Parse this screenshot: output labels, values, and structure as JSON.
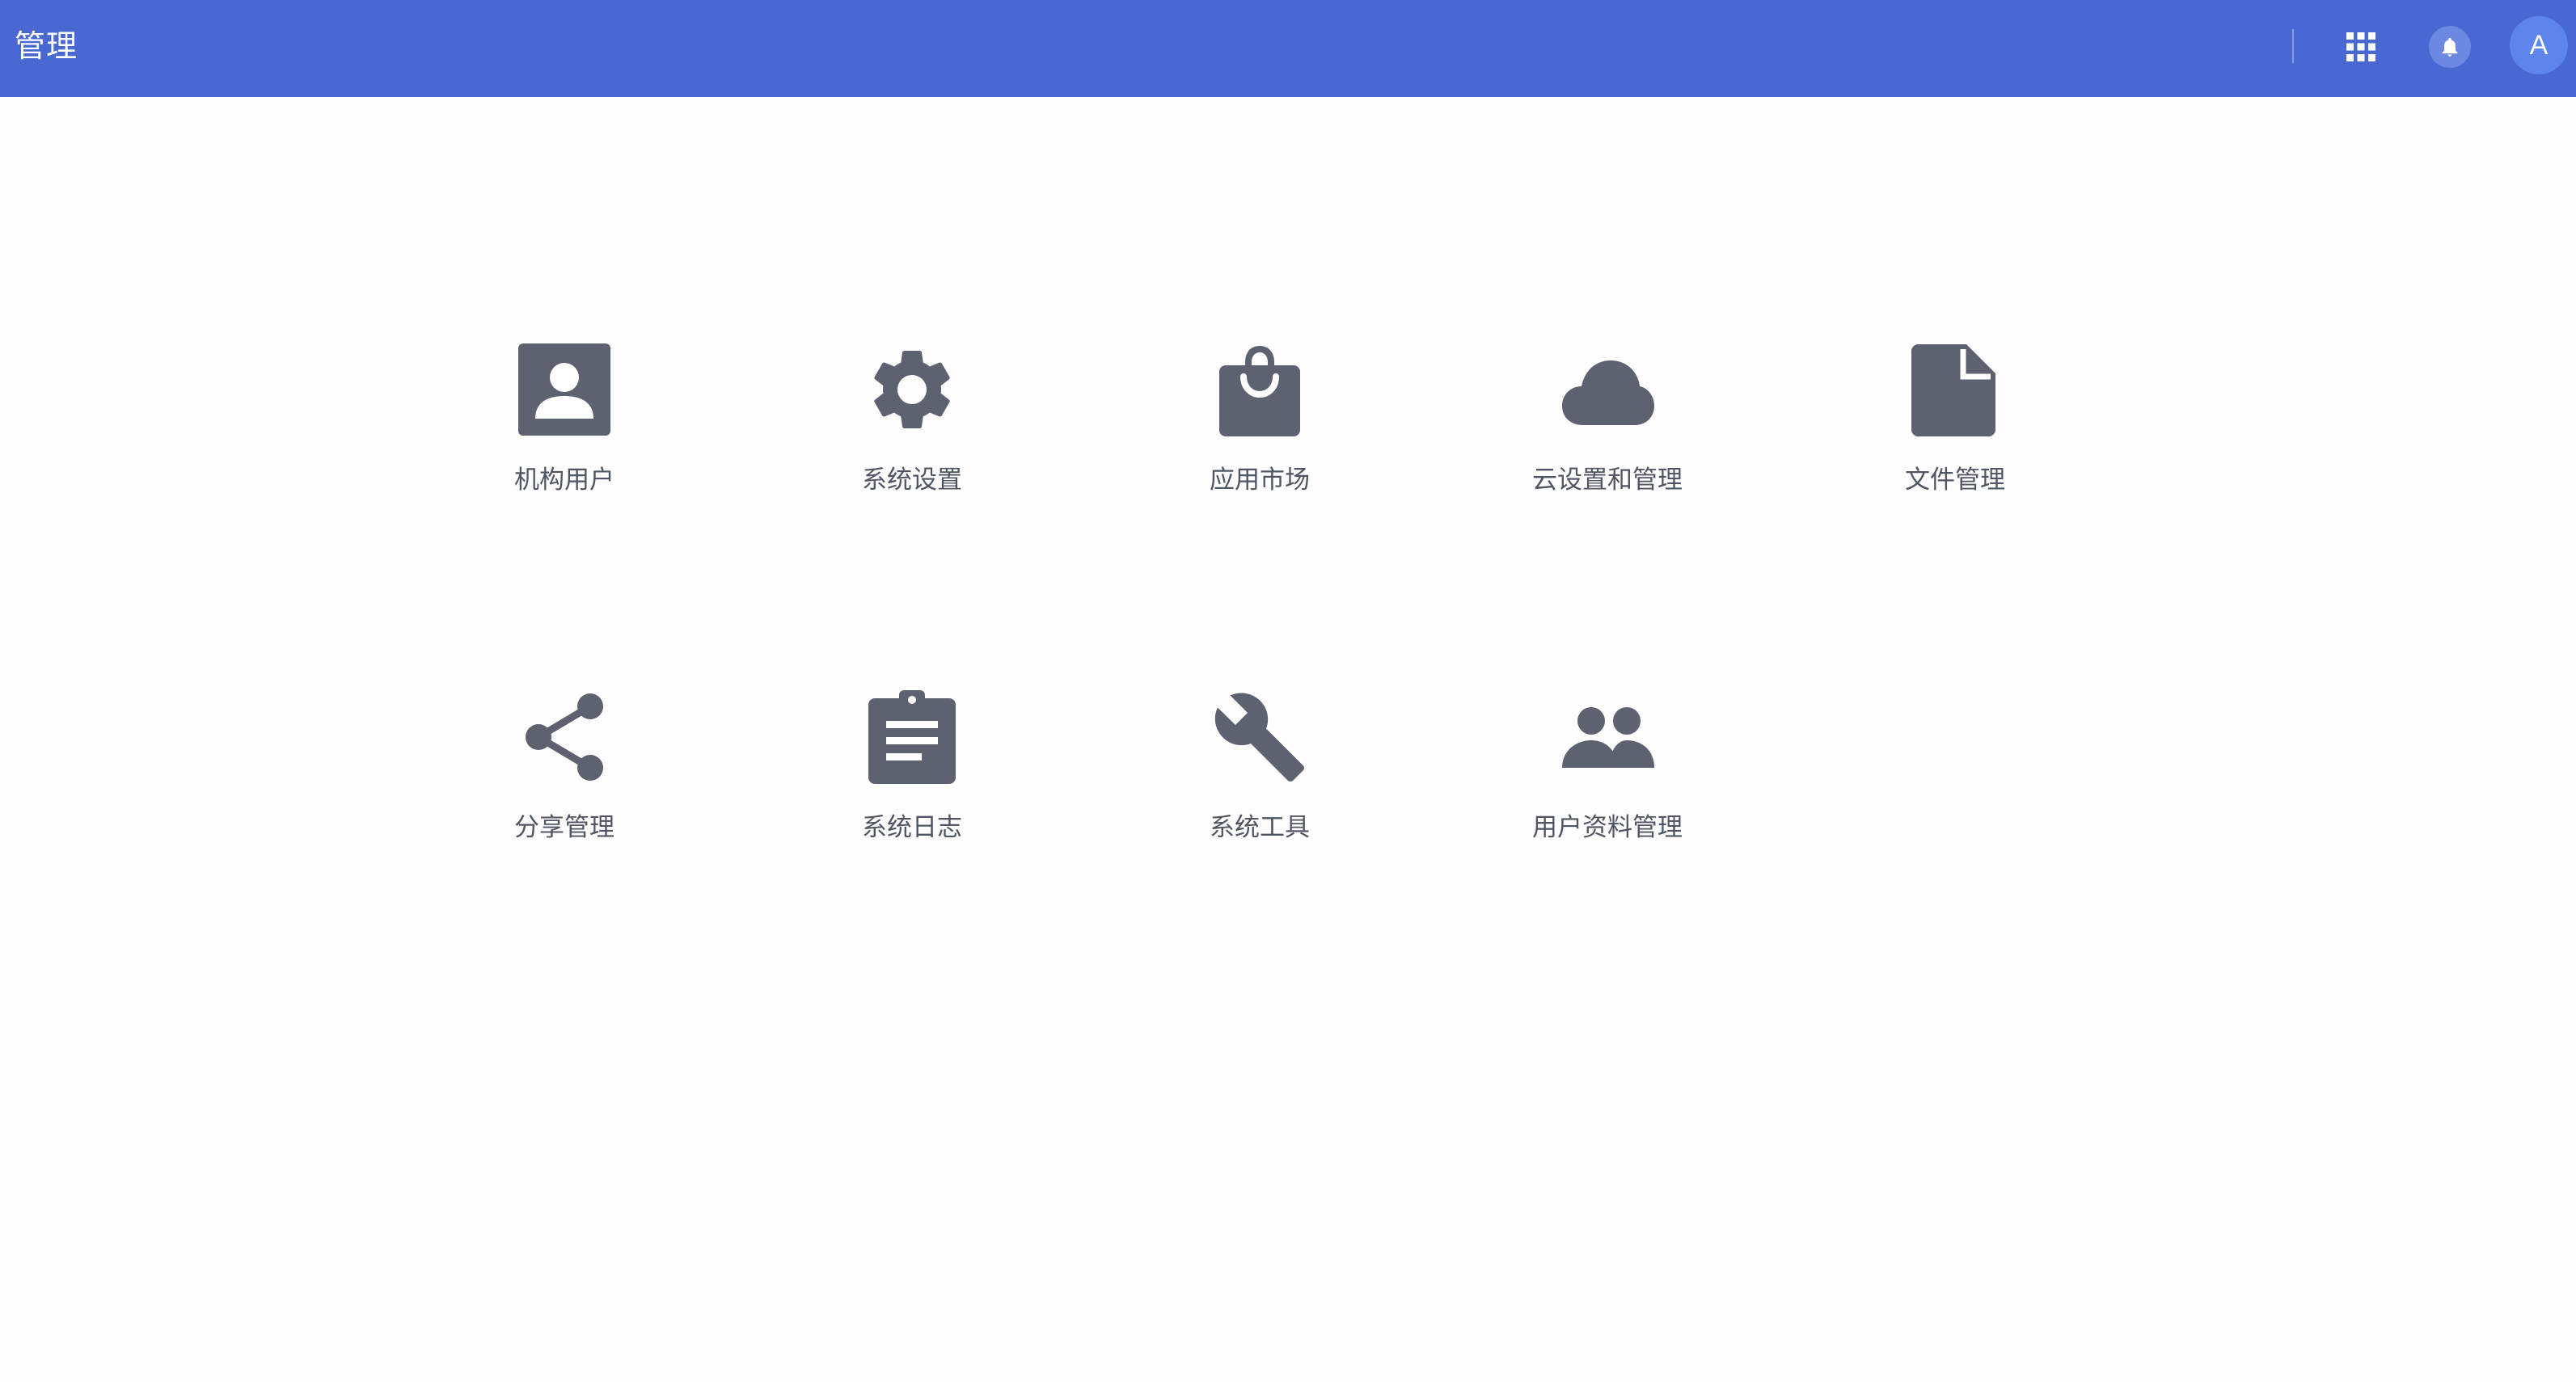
{
  "header": {
    "title": "管理",
    "avatar_letter": "A",
    "apps_icon": "grid-apps-icon",
    "notify_icon": "bell-icon"
  },
  "colors": {
    "header_bg": "#4a68d2",
    "icon_color": "#5e6170",
    "label_color": "#4f5562"
  },
  "tiles": [
    {
      "label": "机构用户",
      "icon": "contact-card-icon"
    },
    {
      "label": "系统设置",
      "icon": "gear-icon"
    },
    {
      "label": "应用市场",
      "icon": "shopping-bag-icon"
    },
    {
      "label": "云设置和管理",
      "icon": "cloud-icon"
    },
    {
      "label": "文件管理",
      "icon": "file-icon"
    },
    {
      "label": "分享管理",
      "icon": "share-icon"
    },
    {
      "label": "系统日志",
      "icon": "clipboard-icon"
    },
    {
      "label": "系统工具",
      "icon": "wrench-icon"
    },
    {
      "label": "用户资料管理",
      "icon": "people-icon"
    }
  ]
}
